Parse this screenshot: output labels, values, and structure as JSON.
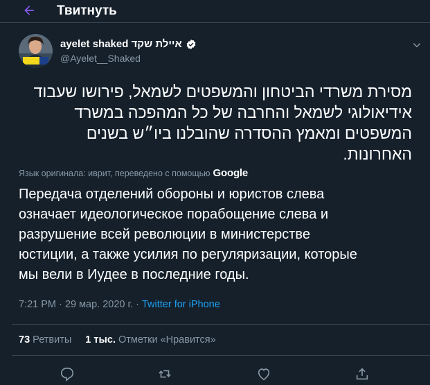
{
  "header": {
    "title": "Твитнуть"
  },
  "author": {
    "display_name": "ayelet shaked איילת שקד",
    "handle": "@Ayelet__Shaked"
  },
  "tweet": {
    "original_lines": [
      "מסירת משרדי הביטחון והמשפטים לשמאל, פירושו שעבוד",
      "אידיאולוגי לשמאל והחרבה של כל המהפכה במשרד",
      "המשפטים ומאמץ ההסדרה שהובלנו ביו״ש בשנים",
      "האחרונות."
    ],
    "translated_note": "Язык оригинала: иврит, переведено с помощью",
    "translator": "Google",
    "translation_lines": [
      "Передача отделений обороны и юристов слева",
      "означает идеологическое порабощение слева и",
      "разрушение всей революции в министерстве",
      "юстиции, а также усилия по регуляризации, которые",
      "мы вели в Иудее в последние годы."
    ],
    "time": "7:21 PM",
    "date": "29 мар. 2020 г.",
    "separator": "·",
    "source": "Twitter for iPhone"
  },
  "stats": {
    "retweets_count": "73",
    "retweets_label": "Ретвиты",
    "likes_count": "1 тыс.",
    "likes_label": "Отметки «Нравится»"
  },
  "icons": {
    "back": "arrow-left-icon",
    "verified": "verified-badge-icon",
    "more": "chevron-down-icon",
    "reply": "reply-icon",
    "retweet": "retweet-icon",
    "like": "heart-icon",
    "share": "share-icon"
  },
  "colors": {
    "background": "#15202b",
    "accent": "#1da1f2",
    "secondary_text": "#8899a6",
    "border": "#38444d",
    "back_arrow": "#8b5cf6"
  }
}
